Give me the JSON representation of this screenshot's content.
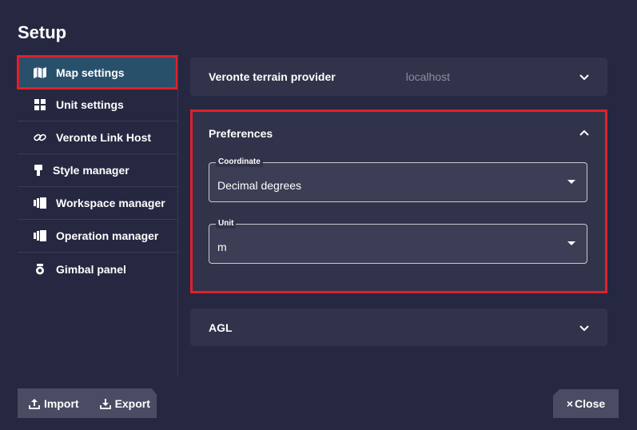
{
  "header": {
    "title": "Setup"
  },
  "sidebar": {
    "items": [
      {
        "label": "Map settings",
        "icon": "map-icon",
        "active": true
      },
      {
        "label": "Unit settings",
        "icon": "grid-icon"
      },
      {
        "label": "Veronte Link Host",
        "icon": "link-icon"
      },
      {
        "label": "Style manager",
        "icon": "brush-icon"
      },
      {
        "label": "Workspace manager",
        "icon": "layers-icon"
      },
      {
        "label": "Operation manager",
        "icon": "layers-icon"
      },
      {
        "label": "Gimbal panel",
        "icon": "gimbal-icon"
      }
    ]
  },
  "panels": {
    "terrain": {
      "label": "Veronte terrain provider",
      "value": "localhost"
    },
    "preferences": {
      "label": "Preferences",
      "coordinate": {
        "label": "Coordinate",
        "value": "Decimal degrees"
      },
      "unit": {
        "label": "Unit",
        "value": "m"
      }
    },
    "agl": {
      "label": "AGL"
    }
  },
  "footer": {
    "import_label": "Import",
    "export_label": "Export",
    "close_label": "Close"
  },
  "colors": {
    "background": "#262841",
    "panel": "#31334a",
    "active": "#29506b",
    "highlight": "#e0202a"
  }
}
